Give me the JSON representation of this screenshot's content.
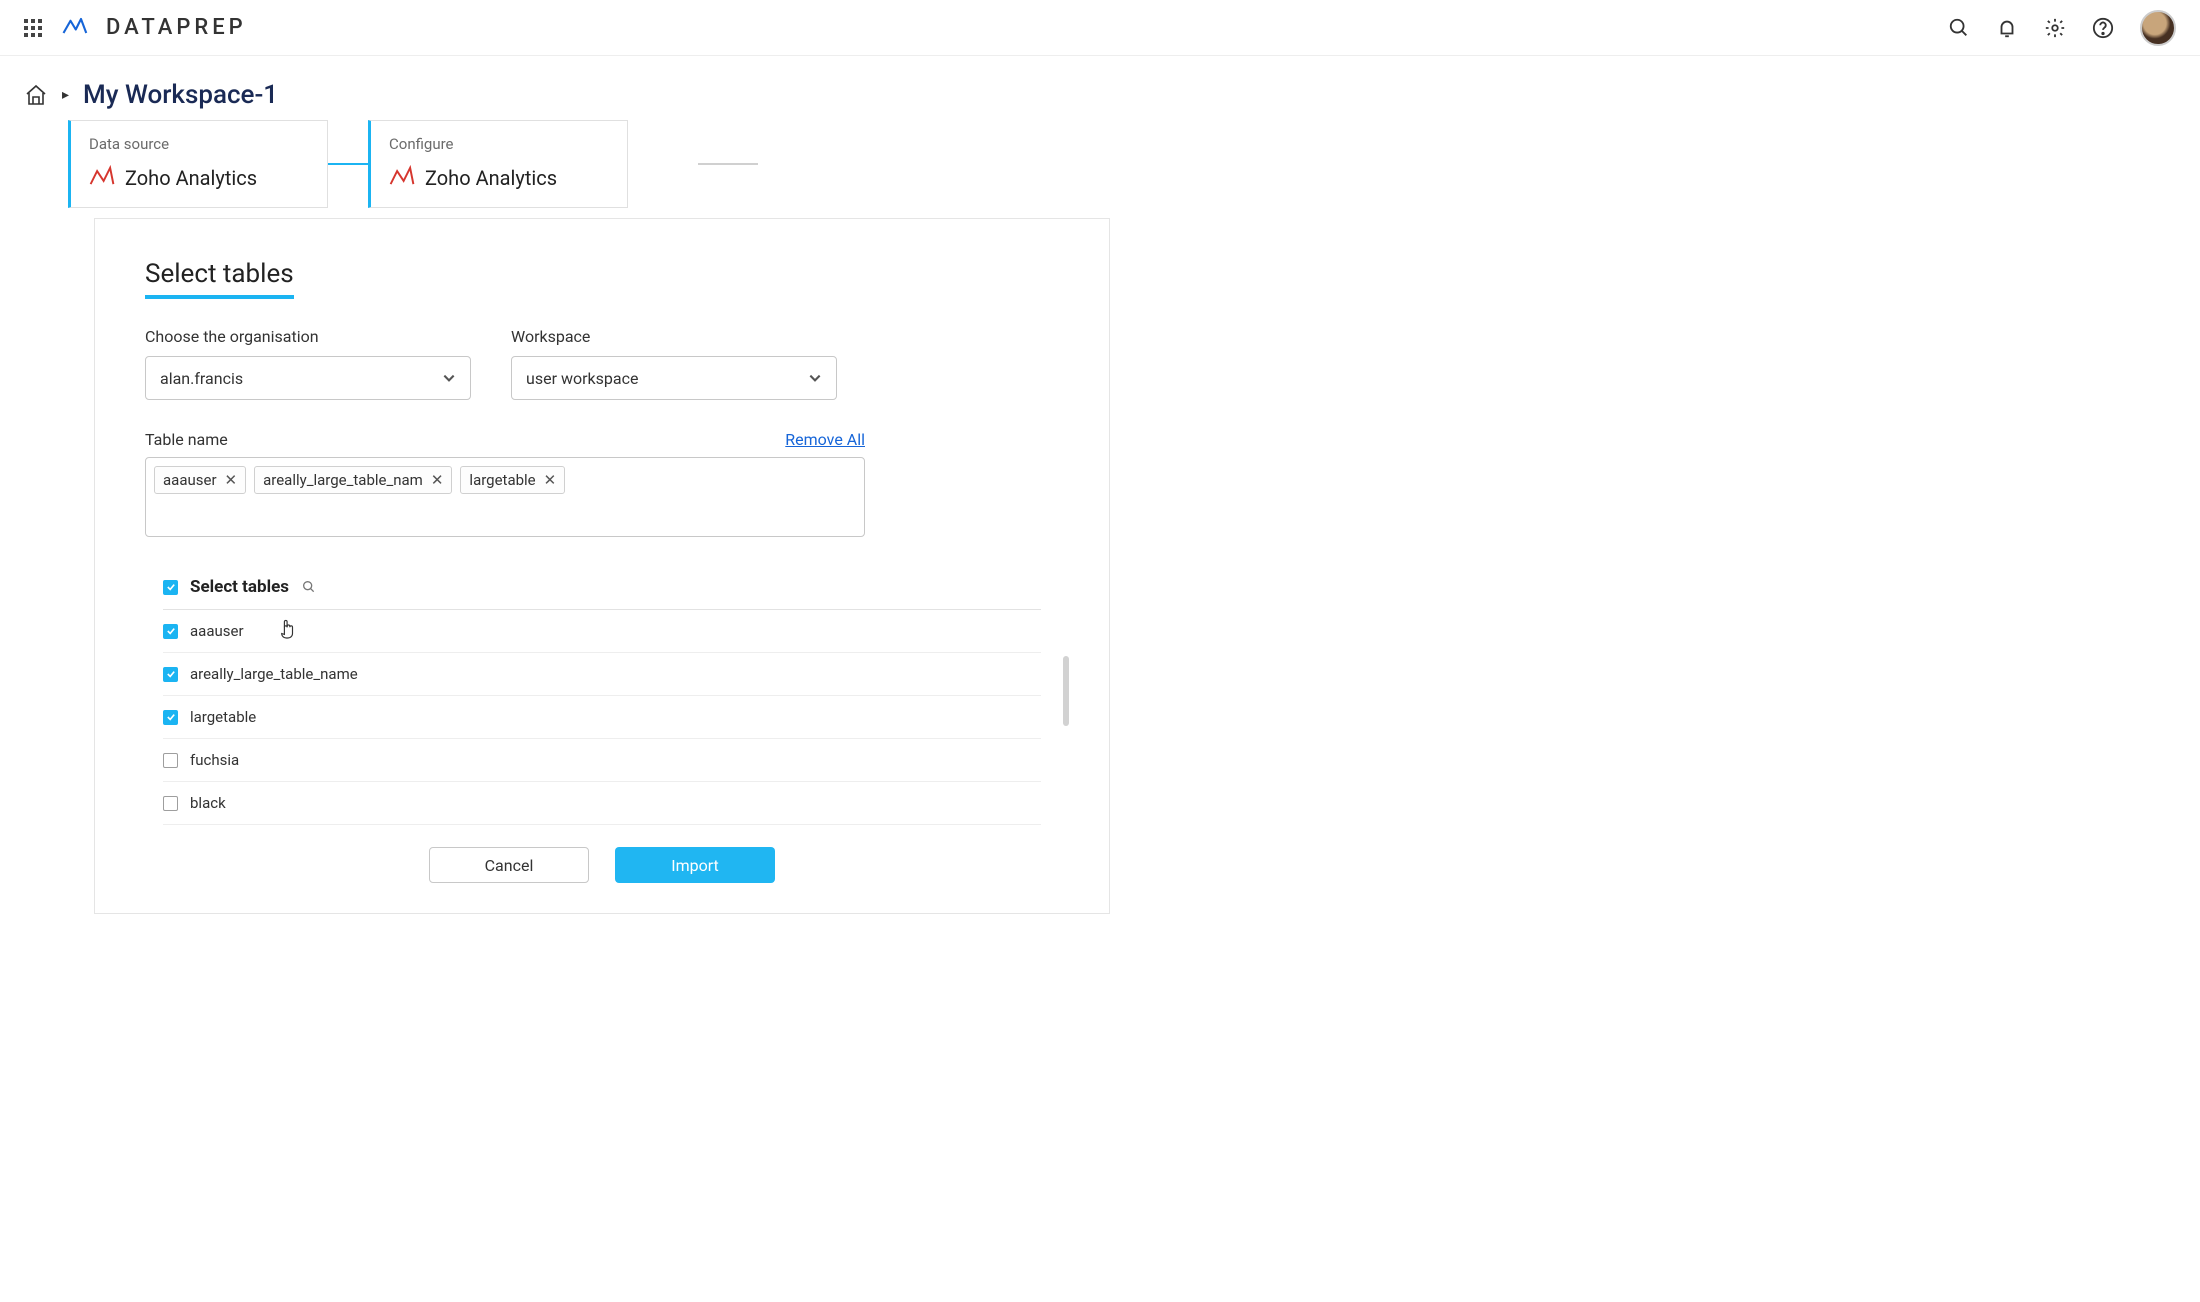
{
  "header": {
    "brand": "DATAPREP"
  },
  "breadcrumb": {
    "workspace": "My Workspace-1"
  },
  "steps": {
    "card1_label": "Data source",
    "card1_name": "Zoho Analytics",
    "card2_label": "Configure",
    "card2_name": "Zoho Analytics"
  },
  "panel": {
    "title": "Select tables",
    "org_label": "Choose the organisation",
    "org_value": "alan.francis",
    "workspace_label": "Workspace",
    "workspace_value": "user workspace",
    "tablename_label": "Table name",
    "remove_all": "Remove All",
    "chips": {
      "0": "aaauser",
      "1": "areally_large_table_nam",
      "2": "largetable"
    },
    "list_header": "Select tables",
    "tables": {
      "0": {
        "name": "aaauser"
      },
      "1": {
        "name": "areally_large_table_name"
      },
      "2": {
        "name": "largetable"
      },
      "3": {
        "name": "fuchsia"
      },
      "4": {
        "name": "black"
      }
    },
    "cancel": "Cancel",
    "import": "Import"
  }
}
